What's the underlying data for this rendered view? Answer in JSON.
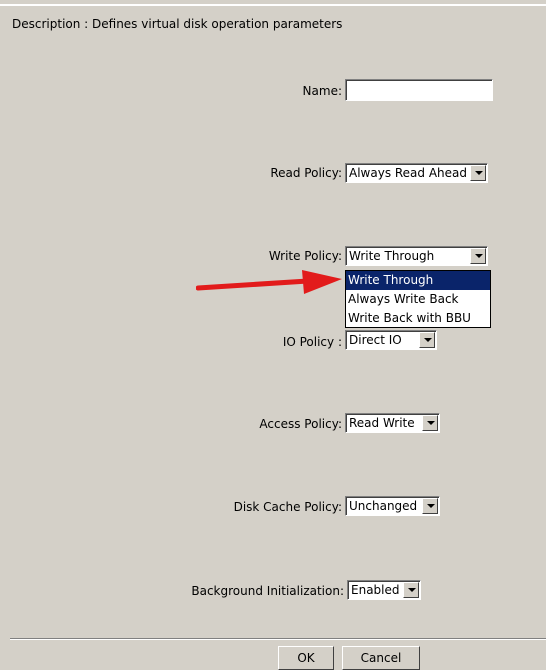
{
  "description": "Description : Defines virtual disk operation parameters",
  "form": {
    "name": {
      "label": "Name:",
      "value": ""
    },
    "read_policy": {
      "label": "Read Policy:",
      "value": "Always Read Ahead"
    },
    "write_policy": {
      "label": "Write Policy:",
      "value": "Write Through",
      "options": [
        "Write Through",
        "Always Write Back",
        "Write Back with BBU"
      ],
      "selected_index": 0
    },
    "io_policy": {
      "label": "IO Policy :",
      "value": "Direct IO"
    },
    "access_policy": {
      "label": "Access Policy:",
      "value": "Read Write"
    },
    "disk_cache_policy": {
      "label": "Disk Cache Policy:",
      "value": "Unchanged"
    },
    "background_initialization": {
      "label": "Background Initialization:",
      "value": "Enabled"
    }
  },
  "buttons": {
    "ok": "OK",
    "cancel": "Cancel"
  },
  "colors": {
    "annotation_arrow": "#e21b1b",
    "selection": "#0a246a",
    "panel": "#d4d0c8"
  }
}
